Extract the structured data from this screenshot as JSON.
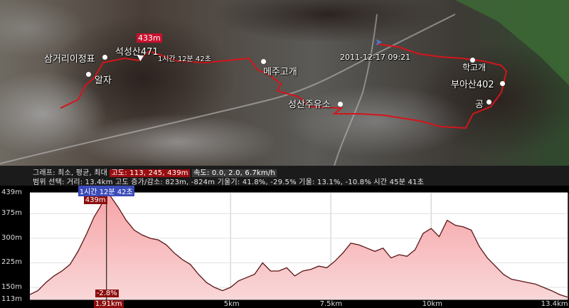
{
  "map": {
    "labels": {
      "peak_elev": "433m",
      "seonsan": "석성산471",
      "duration": "1시간 12분 42초",
      "samgeori": "삼거리이정표",
      "alja": "알자",
      "meju": "메주고개",
      "datetime": "2011-12-17 09:21",
      "hakgo": "학고개",
      "buasan": "부아산402",
      "gong": "공",
      "seongsan_gas": "성산주유소"
    }
  },
  "info": {
    "line1_prefix": "그래프: 최소, 평균, 최대",
    "line1_alt_label": "고도: 113, 245, 439m",
    "line1_speed": "속도: 0.0, 2.0, 6.7km/h",
    "line2_prefix": "범위 선택: 거리: 13.4km 고도 증가/감소: 823m,  -824m 기울기: 41.8%, -29.5% 기울: 13.1%, -10.8% 시간 45분 41초"
  },
  "chart": {
    "cursor_time": "1시간 12분 42초",
    "cursor_elev": "439m",
    "cursor_slope": "-2.8%",
    "cursor_dist": "1.91km"
  },
  "chart_data": {
    "type": "area",
    "title": "",
    "xlabel": "",
    "ylabel": "",
    "x_unit": "km",
    "y_unit": "m",
    "xlim": [
      0,
      13.4
    ],
    "ylim": [
      113,
      439
    ],
    "yticks": [
      "113m",
      "150m",
      "225m",
      "300m",
      "375m",
      "439m"
    ],
    "ytick_values": [
      113,
      150,
      225,
      300,
      375,
      439
    ],
    "xticks": [
      "5km",
      "7.5km",
      "10km",
      "13.4km"
    ],
    "xtick_values": [
      5,
      7.5,
      10,
      13.4
    ],
    "x": [
      0,
      0.2,
      0.4,
      0.6,
      0.8,
      1.0,
      1.2,
      1.4,
      1.6,
      1.75,
      1.85,
      1.91,
      2.0,
      2.2,
      2.4,
      2.6,
      2.8,
      3.0,
      3.2,
      3.4,
      3.6,
      3.8,
      4.0,
      4.2,
      4.4,
      4.6,
      4.8,
      5.0,
      5.2,
      5.4,
      5.6,
      5.8,
      6.0,
      6.2,
      6.4,
      6.6,
      6.8,
      7.0,
      7.2,
      7.4,
      7.6,
      7.8,
      8.0,
      8.2,
      8.4,
      8.6,
      8.8,
      9.0,
      9.2,
      9.4,
      9.6,
      9.8,
      10.0,
      10.2,
      10.4,
      10.6,
      10.8,
      11.0,
      11.2,
      11.4,
      11.6,
      11.8,
      12.0,
      12.2,
      12.4,
      12.6,
      12.8,
      13.0,
      13.2,
      13.4
    ],
    "series": [
      {
        "values": [
          128,
          140,
          165,
          185,
          200,
          220,
          260,
          310,
          365,
          395,
          420,
          439,
          430,
          395,
          355,
          325,
          310,
          300,
          295,
          280,
          255,
          235,
          220,
          190,
          165,
          150,
          140,
          150,
          170,
          180,
          190,
          225,
          200,
          200,
          210,
          185,
          200,
          205,
          215,
          210,
          230,
          255,
          285,
          280,
          270,
          260,
          270,
          240,
          250,
          245,
          265,
          315,
          330,
          305,
          355,
          340,
          335,
          325,
          275,
          240,
          215,
          190,
          175,
          170,
          165,
          160,
          150,
          140,
          128,
          120
        ]
      }
    ]
  }
}
